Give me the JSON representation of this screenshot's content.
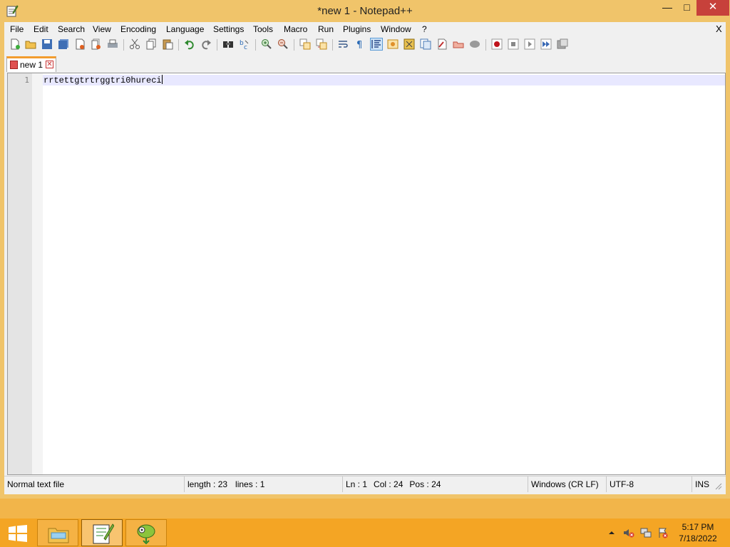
{
  "window": {
    "title": "*new 1 - Notepad++",
    "minimize_glyph": "—",
    "maximize_glyph": "□",
    "close_glyph": "✕"
  },
  "menu": {
    "items": [
      "File",
      "Edit",
      "Search",
      "View",
      "Encoding",
      "Language",
      "Settings",
      "Tools",
      "Macro",
      "Run",
      "Plugins",
      "Window",
      "?"
    ],
    "close_glyph": "X"
  },
  "toolbar": {
    "icons": [
      "new-file-icon",
      "open-file-icon",
      "save-icon",
      "save-all-icon",
      "close-icon",
      "close-all-icon",
      "print-icon",
      "cut-icon",
      "copy-icon",
      "paste-icon",
      "undo-icon",
      "redo-icon",
      "find-icon",
      "replace-icon",
      "zoom-in-icon",
      "zoom-out-icon",
      "sync-vertical-icon",
      "sync-horizontal-icon",
      "word-wrap-icon",
      "show-all-chars-icon",
      "indent-guide-icon",
      "user-defined-language-icon",
      "document-map-icon",
      "function-list-icon",
      "folder-as-workspace-icon",
      "monitoring-icon",
      "record-macro-icon",
      "stop-recording-icon",
      "playback-macro-icon",
      "run-macro-multiple-icon",
      "save-macro-icon"
    ]
  },
  "tabs": [
    {
      "label": "new 1",
      "close_glyph": "✕"
    }
  ],
  "editor": {
    "line_number": "1",
    "content": "rrtettgtrtrggtri0hureci"
  },
  "status": {
    "file_type": "Normal text file",
    "length": "length : 23",
    "lines": "lines : 1",
    "ln": "Ln : 1",
    "col": "Col : 24",
    "pos": "Pos : 24",
    "eol": "Windows (CR LF)",
    "encoding": "UTF-8",
    "mode": "INS"
  },
  "taskbar": {
    "apps": [
      "start-icon",
      "file-explorer-icon",
      "notepad-plus-plus-icon",
      "chameleon-app-icon"
    ],
    "tray": [
      "show-hidden-icons-icon",
      "volume-muted-icon",
      "network-icon",
      "action-center-icon"
    ],
    "time": "5:17 PM",
    "date": "7/18/2022"
  },
  "colors": {
    "titlebar": "#f0c46a",
    "close_button": "#c7413b",
    "tab_accent": "#f39c2e",
    "taskbar": "#f4a524"
  }
}
